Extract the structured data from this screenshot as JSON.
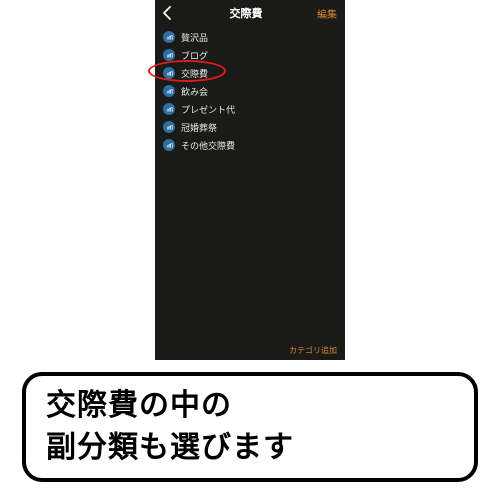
{
  "header": {
    "title": "交際費",
    "edit_label": "編集"
  },
  "categories": {
    "items": [
      {
        "label": "贅沢品"
      },
      {
        "label": "ブログ"
      },
      {
        "label": "交際費"
      },
      {
        "label": "飲み会"
      },
      {
        "label": "プレゼント代"
      },
      {
        "label": "冠婚葬祭"
      },
      {
        "label": "その他交際費"
      }
    ]
  },
  "footer": {
    "add_category_label": "カテゴリ追加"
  },
  "caption": {
    "line1": "交際費の中の",
    "line2": "副分類も選びます"
  },
  "colors": {
    "accent": "#d68a2e",
    "icon_bg": "#2e6ea3",
    "highlight": "#e11b1b"
  }
}
